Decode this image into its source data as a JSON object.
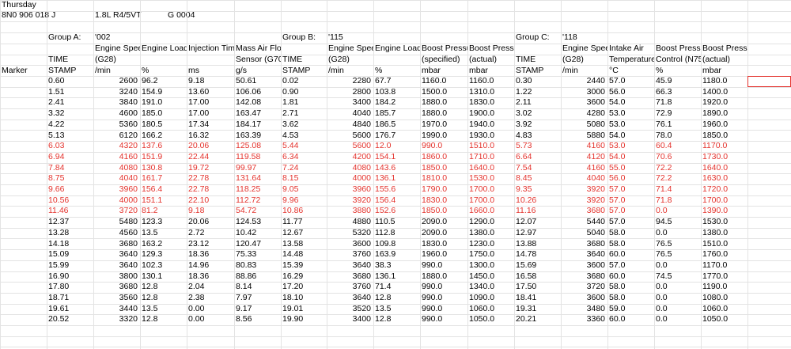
{
  "meta": {
    "day": "Thursday",
    "part_no": "8N0 906 018 J",
    "engine": "1.8L R4/5VT",
    "code": "G   0004"
  },
  "groups": [
    {
      "label": "Group A:",
      "id": "'002"
    },
    {
      "label": "Group B:",
      "id": "'115"
    },
    {
      "label": "Group C:",
      "id": "'118"
    }
  ],
  "marker_label": "Marker",
  "headers": [
    {
      "l1": "",
      "l2": "TIME",
      "l3": "STAMP"
    },
    {
      "l1": "Engine Speed",
      "l2": "(G28)",
      "l3": "/min"
    },
    {
      "l1": "Engine Load",
      "l2": "",
      "l3": "%"
    },
    {
      "l1": "Injection Time",
      "l2": "",
      "l3": "ms"
    },
    {
      "l1": "Mass Air Flow",
      "l2": "Sensor (G70)",
      "l3": "g/s"
    },
    {
      "l1": "",
      "l2": "TIME",
      "l3": "STAMP"
    },
    {
      "l1": "Engine Speed",
      "l2": "(G28)",
      "l3": "/min"
    },
    {
      "l1": "Engine Load",
      "l2": "",
      "l3": "%"
    },
    {
      "l1": "Boost Pressure",
      "l2": "(specified)",
      "l3": "mbar"
    },
    {
      "l1": "Boost Pressure",
      "l2": "(actual)",
      "l3": "mbar"
    },
    {
      "l1": "",
      "l2": "TIME",
      "l3": "STAMP"
    },
    {
      "l1": "Engine Speed",
      "l2": "(G28)",
      "l3": "/min"
    },
    {
      "l1": "Intake Air",
      "l2": "Temperature",
      "l3": "°C"
    },
    {
      "l1": "Boost Pressure",
      "l2": "Control (N75)",
      "l3": "%"
    },
    {
      "l1": "Boost Pressure",
      "l2": "(actual)",
      "l3": "mbar"
    }
  ],
  "rows": [
    {
      "red": false,
      "cells": [
        "0.60",
        "2600",
        "96.2",
        "9.18",
        "50.61",
        "0.02",
        "2280",
        "67.7",
        "1160.0",
        "1160.0",
        "0.30",
        "2440",
        "57.0",
        "45.9",
        "1180.0"
      ]
    },
    {
      "red": false,
      "cells": [
        "1.51",
        "3240",
        "154.9",
        "13.60",
        "106.06",
        "0.90",
        "2800",
        "103.8",
        "1500.0",
        "1310.0",
        "1.22",
        "3000",
        "56.0",
        "66.3",
        "1400.0"
      ]
    },
    {
      "red": false,
      "cells": [
        "2.41",
        "3840",
        "191.0",
        "17.00",
        "142.08",
        "1.81",
        "3400",
        "184.2",
        "1880.0",
        "1830.0",
        "2.11",
        "3600",
        "54.0",
        "71.8",
        "1920.0"
      ]
    },
    {
      "red": false,
      "cells": [
        "3.32",
        "4600",
        "185.0",
        "17.00",
        "163.47",
        "2.71",
        "4040",
        "185.7",
        "1880.0",
        "1900.0",
        "3.02",
        "4280",
        "53.0",
        "72.9",
        "1890.0"
      ]
    },
    {
      "red": false,
      "cells": [
        "4.22",
        "5360",
        "180.5",
        "17.34",
        "184.17",
        "3.62",
        "4840",
        "186.5",
        "1970.0",
        "1940.0",
        "3.92",
        "5080",
        "53.0",
        "76.1",
        "1960.0"
      ]
    },
    {
      "red": false,
      "cells": [
        "5.13",
        "6120",
        "166.2",
        "16.32",
        "163.39",
        "4.53",
        "5600",
        "176.7",
        "1990.0",
        "1930.0",
        "4.83",
        "5880",
        "54.0",
        "78.0",
        "1850.0"
      ]
    },
    {
      "red": true,
      "cells": [
        "6.03",
        "4320",
        "137.6",
        "20.06",
        "125.08",
        "5.44",
        "5600",
        "12.0",
        "990.0",
        "1510.0",
        "5.73",
        "4160",
        "53.0",
        "60.4",
        "1170.0"
      ]
    },
    {
      "red": true,
      "cells": [
        "6.94",
        "4160",
        "151.9",
        "22.44",
        "119.58",
        "6.34",
        "4200",
        "154.1",
        "1860.0",
        "1710.0",
        "6.64",
        "4120",
        "54.0",
        "70.6",
        "1730.0"
      ]
    },
    {
      "red": true,
      "cells": [
        "7.84",
        "4080",
        "130.8",
        "19.72",
        "99.97",
        "7.24",
        "4080",
        "143.6",
        "1850.0",
        "1640.0",
        "7.54",
        "4160",
        "55.0",
        "72.2",
        "1640.0"
      ]
    },
    {
      "red": true,
      "cells": [
        "8.75",
        "4040",
        "161.7",
        "22.78",
        "131.64",
        "8.15",
        "4000",
        "136.1",
        "1810.0",
        "1530.0",
        "8.45",
        "4040",
        "56.0",
        "72.2",
        "1630.0"
      ]
    },
    {
      "red": true,
      "cells": [
        "9.66",
        "3960",
        "156.4",
        "22.78",
        "118.25",
        "9.05",
        "3960",
        "155.6",
        "1790.0",
        "1700.0",
        "9.35",
        "3920",
        "57.0",
        "71.4",
        "1720.0"
      ]
    },
    {
      "red": true,
      "cells": [
        "10.56",
        "4000",
        "151.1",
        "22.10",
        "112.72",
        "9.96",
        "3920",
        "156.4",
        "1830.0",
        "1700.0",
        "10.26",
        "3920",
        "57.0",
        "71.8",
        "1700.0"
      ]
    },
    {
      "red": true,
      "cells": [
        "11.46",
        "3720",
        "81.2",
        "9.18",
        "54.72",
        "10.86",
        "3880",
        "152.6",
        "1850.0",
        "1660.0",
        "11.16",
        "3680",
        "57.0",
        "0.0",
        "1390.0"
      ]
    },
    {
      "red": false,
      "cells": [
        "12.37",
        "5480",
        "123.3",
        "20.06",
        "124.53",
        "11.77",
        "4880",
        "110.5",
        "2090.0",
        "1290.0",
        "12.07",
        "5440",
        "57.0",
        "94.5",
        "1530.0"
      ]
    },
    {
      "red": false,
      "cells": [
        "13.28",
        "4560",
        "13.5",
        "2.72",
        "10.42",
        "12.67",
        "5320",
        "112.8",
        "2090.0",
        "1380.0",
        "12.97",
        "5040",
        "58.0",
        "0.0",
        "1380.0"
      ]
    },
    {
      "red": false,
      "cells": [
        "14.18",
        "3680",
        "163.2",
        "23.12",
        "120.47",
        "13.58",
        "3600",
        "109.8",
        "1830.0",
        "1230.0",
        "13.88",
        "3680",
        "58.0",
        "76.5",
        "1510.0"
      ]
    },
    {
      "red": false,
      "cells": [
        "15.09",
        "3640",
        "129.3",
        "18.36",
        "75.33",
        "14.48",
        "3760",
        "163.9",
        "1960.0",
        "1750.0",
        "14.78",
        "3640",
        "60.0",
        "76.5",
        "1760.0"
      ]
    },
    {
      "red": false,
      "cells": [
        "15.99",
        "3640",
        "102.3",
        "14.96",
        "80.83",
        "15.39",
        "3640",
        "38.3",
        "990.0",
        "1300.0",
        "15.69",
        "3600",
        "57.0",
        "0.0",
        "1170.0"
      ]
    },
    {
      "red": false,
      "cells": [
        "16.90",
        "3800",
        "130.1",
        "18.36",
        "88.86",
        "16.29",
        "3680",
        "136.1",
        "1880.0",
        "1450.0",
        "16.58",
        "3680",
        "60.0",
        "74.5",
        "1770.0"
      ]
    },
    {
      "red": false,
      "cells": [
        "17.80",
        "3680",
        "12.8",
        "2.04",
        "8.14",
        "17.20",
        "3760",
        "71.4",
        "990.0",
        "1340.0",
        "17.50",
        "3720",
        "58.0",
        "0.0",
        "1190.0"
      ]
    },
    {
      "red": false,
      "cells": [
        "18.71",
        "3560",
        "12.8",
        "2.38",
        "7.97",
        "18.10",
        "3640",
        "12.8",
        "990.0",
        "1090.0",
        "18.41",
        "3600",
        "58.0",
        "0.0",
        "1080.0"
      ]
    },
    {
      "red": false,
      "cells": [
        "19.61",
        "3440",
        "13.5",
        "0.00",
        "9.17",
        "19.01",
        "3520",
        "13.5",
        "990.0",
        "1060.0",
        "19.31",
        "3480",
        "59.0",
        "0.0",
        "1060.0"
      ]
    },
    {
      "red": false,
      "cells": [
        "20.52",
        "3320",
        "12.8",
        "0.00",
        "8.56",
        "19.90",
        "3400",
        "12.8",
        "990.0",
        "1050.0",
        "20.21",
        "3360",
        "60.0",
        "0.0",
        "1050.0"
      ]
    }
  ]
}
